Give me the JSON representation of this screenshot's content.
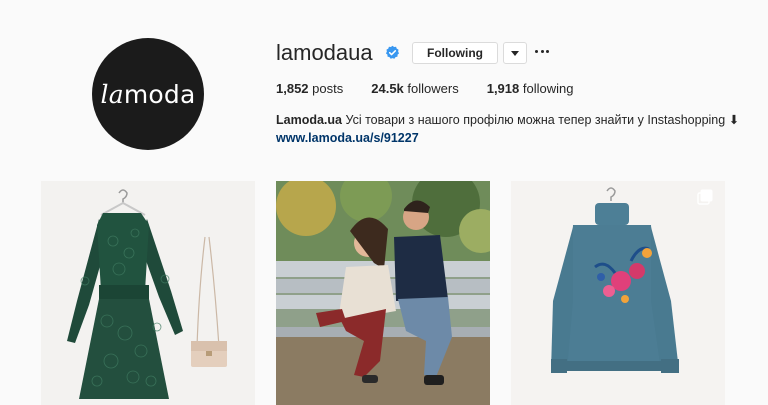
{
  "profile": {
    "username": "lamodaua",
    "avatar_la": "la",
    "avatar_moda": "moda",
    "follow_label": "Following",
    "posts_count": "1,852",
    "posts_label": "posts",
    "followers_count": "24.5k",
    "followers_label": "followers",
    "following_count": "1,918",
    "following_label": "following",
    "bio_name": "Lamoda.ua",
    "bio_text": "Усі товари з нашого профілю можна тепер знайти у Instashopping",
    "bio_arrow": "⬇",
    "bio_link": "www.lamoda.ua/s/91227"
  },
  "colors": {
    "verified": "#3897f0",
    "link": "#003569",
    "avatar_bg": "#1b1b1b"
  },
  "icons": [
    "verified-badge-icon",
    "chevron-down-icon",
    "more-options-icon",
    "multiple-photos-icon"
  ],
  "posts": [
    {
      "subject": "green lace dress with beige bag"
    },
    {
      "subject": "couple laughing on bench"
    },
    {
      "subject": "blue floral sweater"
    }
  ]
}
